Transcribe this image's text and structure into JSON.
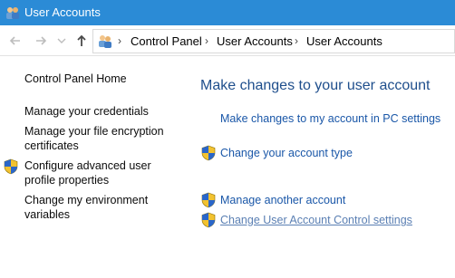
{
  "window": {
    "title": "User Accounts"
  },
  "address_bar": {
    "breadcrumbs": [
      "Control Panel",
      "User Accounts",
      "User Accounts"
    ]
  },
  "sidebar": {
    "items": [
      {
        "label": "Control Panel Home",
        "shield": false
      },
      {
        "label": "Manage your credentials",
        "shield": false
      },
      {
        "label": "Manage your file encryption certificates",
        "shield": false
      },
      {
        "label": "Configure advanced user profile properties",
        "shield": true
      },
      {
        "label": "Change my environment variables",
        "shield": false
      }
    ]
  },
  "main": {
    "heading": "Make changes to your user account",
    "tasks": [
      {
        "label": "Make changes to my account in PC settings",
        "shield": false
      },
      {
        "label": "Change your account type",
        "shield": true
      },
      {
        "label": "Manage another account",
        "shield": true
      },
      {
        "label": "Change User Account Control settings",
        "shield": true
      }
    ]
  },
  "icons": {
    "titlebar": "users-icon",
    "back": "back-arrow-icon",
    "forward": "forward-arrow-icon",
    "recent": "chevron-down-icon",
    "up": "up-arrow-icon",
    "address": "users-icon",
    "shield": "uac-shield-icon"
  },
  "colors": {
    "titlebar": "#2b8bd6",
    "link": "#1a57a8",
    "heading": "#1e4e8c"
  }
}
